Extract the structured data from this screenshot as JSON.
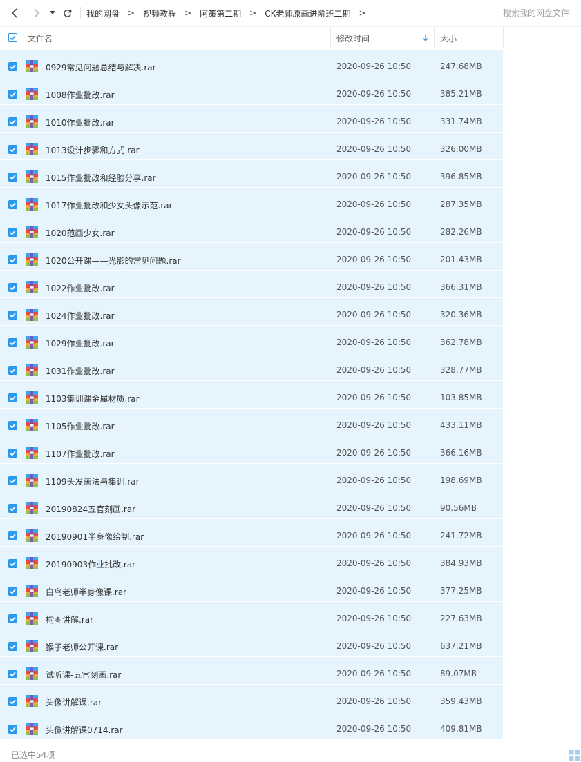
{
  "nav": {
    "back_icon": "chevron-left-icon",
    "forward_icon": "chevron-right-icon",
    "history_icon": "caret-down-icon",
    "refresh_icon": "refresh-icon"
  },
  "breadcrumb": {
    "separator": ">",
    "items": [
      "我的网盘",
      "视频教程",
      "阿策第二期",
      "CK老师原画进阶班二期"
    ]
  },
  "search": {
    "placeholder": "搜索我的网盘文件"
  },
  "columns": {
    "name": "文件名",
    "modified": "修改时间",
    "size": "大小",
    "sort_icon": "sort-down-arrow-icon"
  },
  "colors": {
    "accent": "#2c9cf0",
    "row_selected": "#e5f4fd"
  },
  "files": [
    {
      "name": "0929常见问题总结与解决.rar",
      "modified": "2020-09-26 10:50",
      "size": "247.68MB",
      "icon": "rar-archive-icon"
    },
    {
      "name": "1008作业批改.rar",
      "modified": "2020-09-26 10:50",
      "size": "385.21MB",
      "icon": "rar-archive-icon"
    },
    {
      "name": "1010作业批改.rar",
      "modified": "2020-09-26 10:50",
      "size": "331.74MB",
      "icon": "rar-archive-icon"
    },
    {
      "name": "1013设计步骤和方式.rar",
      "modified": "2020-09-26 10:50",
      "size": "326.00MB",
      "icon": "rar-archive-icon"
    },
    {
      "name": "1015作业批改和经验分享.rar",
      "modified": "2020-09-26 10:50",
      "size": "396.85MB",
      "icon": "rar-archive-icon"
    },
    {
      "name": "1017作业批改和少女头像示范.rar",
      "modified": "2020-09-26 10:50",
      "size": "287.35MB",
      "icon": "rar-archive-icon"
    },
    {
      "name": "1020范画少女.rar",
      "modified": "2020-09-26 10:50",
      "size": "282.26MB",
      "icon": "rar-archive-icon"
    },
    {
      "name": "1020公开课——光影的常见问题.rar",
      "modified": "2020-09-26 10:50",
      "size": "201.43MB",
      "icon": "rar-archive-icon"
    },
    {
      "name": "1022作业批改.rar",
      "modified": "2020-09-26 10:50",
      "size": "366.31MB",
      "icon": "rar-archive-icon"
    },
    {
      "name": "1024作业批改.rar",
      "modified": "2020-09-26 10:50",
      "size": "320.36MB",
      "icon": "rar-archive-icon"
    },
    {
      "name": "1029作业批改.rar",
      "modified": "2020-09-26 10:50",
      "size": "362.78MB",
      "icon": "rar-archive-icon"
    },
    {
      "name": "1031作业批改.rar",
      "modified": "2020-09-26 10:50",
      "size": "328.77MB",
      "icon": "rar-archive-icon"
    },
    {
      "name": "1103集训课金属材质.rar",
      "modified": "2020-09-26 10:50",
      "size": "103.85MB",
      "icon": "rar-archive-icon"
    },
    {
      "name": "1105作业批改.rar",
      "modified": "2020-09-26 10:50",
      "size": "433.11MB",
      "icon": "rar-archive-icon"
    },
    {
      "name": "1107作业批改.rar",
      "modified": "2020-09-26 10:50",
      "size": "366.16MB",
      "icon": "rar-archive-icon"
    },
    {
      "name": "1109头发画法与集训.rar",
      "modified": "2020-09-26 10:50",
      "size": "198.69MB",
      "icon": "rar-archive-icon"
    },
    {
      "name": "20190824五官刻画.rar",
      "modified": "2020-09-26 10:50",
      "size": "90.56MB",
      "icon": "rar-archive-icon"
    },
    {
      "name": "20190901半身像绘制.rar",
      "modified": "2020-09-26 10:50",
      "size": "241.72MB",
      "icon": "rar-archive-icon"
    },
    {
      "name": "20190903作业批改.rar",
      "modified": "2020-09-26 10:50",
      "size": "384.93MB",
      "icon": "rar-archive-icon"
    },
    {
      "name": "白鸟老师半身像课.rar",
      "modified": "2020-09-26 10:50",
      "size": "377.25MB",
      "icon": "rar-archive-icon"
    },
    {
      "name": "构图讲解.rar",
      "modified": "2020-09-26 10:50",
      "size": "227.63MB",
      "icon": "rar-archive-icon"
    },
    {
      "name": "猴子老师公开课.rar",
      "modified": "2020-09-26 10:50",
      "size": "637.21MB",
      "icon": "rar-archive-icon"
    },
    {
      "name": "试听课-五官刻画.rar",
      "modified": "2020-09-26 10:50",
      "size": "89.07MB",
      "icon": "rar-archive-icon"
    },
    {
      "name": "头像讲解课.rar",
      "modified": "2020-09-26 10:50",
      "size": "359.43MB",
      "icon": "rar-archive-icon"
    },
    {
      "name": "头像讲解课0714.rar",
      "modified": "2020-09-26 10:50",
      "size": "409.81MB",
      "icon": "rar-archive-icon"
    }
  ],
  "status": {
    "text": "已选中54项",
    "view_icon": "grid-view-icon"
  }
}
